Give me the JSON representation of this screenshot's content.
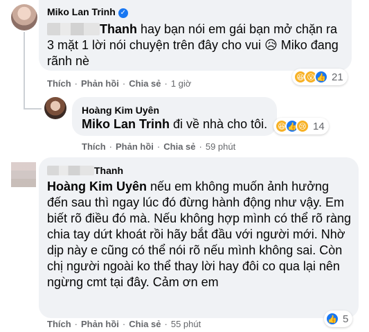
{
  "comments": [
    {
      "author": "Miko Lan Trinh",
      "verified": true,
      "text_prefix_mention": "Thanh",
      "text": " hay bạn nói em gái bạn mở chặn ra 3 mặt 1 lời nói chuyện trên đây cho vui 😥 Miko đang rãnh nè",
      "reaction_count": "21",
      "actions": {
        "like": "Thích",
        "reply": "Phản hồi",
        "share": "Chia sẻ",
        "time": "1 giờ"
      }
    },
    {
      "author": "Hoàng Kim Uyên",
      "mention": "Miko Lan Trinh",
      "text": " đi về nhà cho tôi.",
      "reaction_count": "14",
      "actions": {
        "like": "Thích",
        "reply": "Phản hồi",
        "share": "Chia sẻ",
        "time": "59 phút"
      }
    },
    {
      "author": "Thanh",
      "mention": "Hoàng Kim Uyên",
      "text": " nếu em không muốn ảnh hưởng đến sau thì ngay lúc đó đừng hành động như vậy. Em biết rõ điều đó mà. Nếu không hợp mình có thể rõ ràng chia tay dứt khoát rồi hãy bắt đầu với người mới. Nhờ dịp này e cũng có thể nói rõ nếu mình không sai. Còn chị người ngoài ko thể thay lời hay đôi co qua lại nên ngừng cmt tại đây. Cảm ơn em",
      "reaction_count": "5",
      "actions": {
        "like": "Thích",
        "reply": "Phản hồi",
        "share": "Chia sẻ",
        "time": "55 phút"
      }
    }
  ],
  "icons": {
    "verified": "verified-badge-icon",
    "haha": "haha-reaction-icon",
    "wow": "wow-reaction-icon",
    "like": "like-reaction-icon",
    "sad": "sad-reaction-icon"
  },
  "colors": {
    "bubble": "#f0f2f5",
    "link": "#1877f2",
    "meta": "#65676b"
  }
}
